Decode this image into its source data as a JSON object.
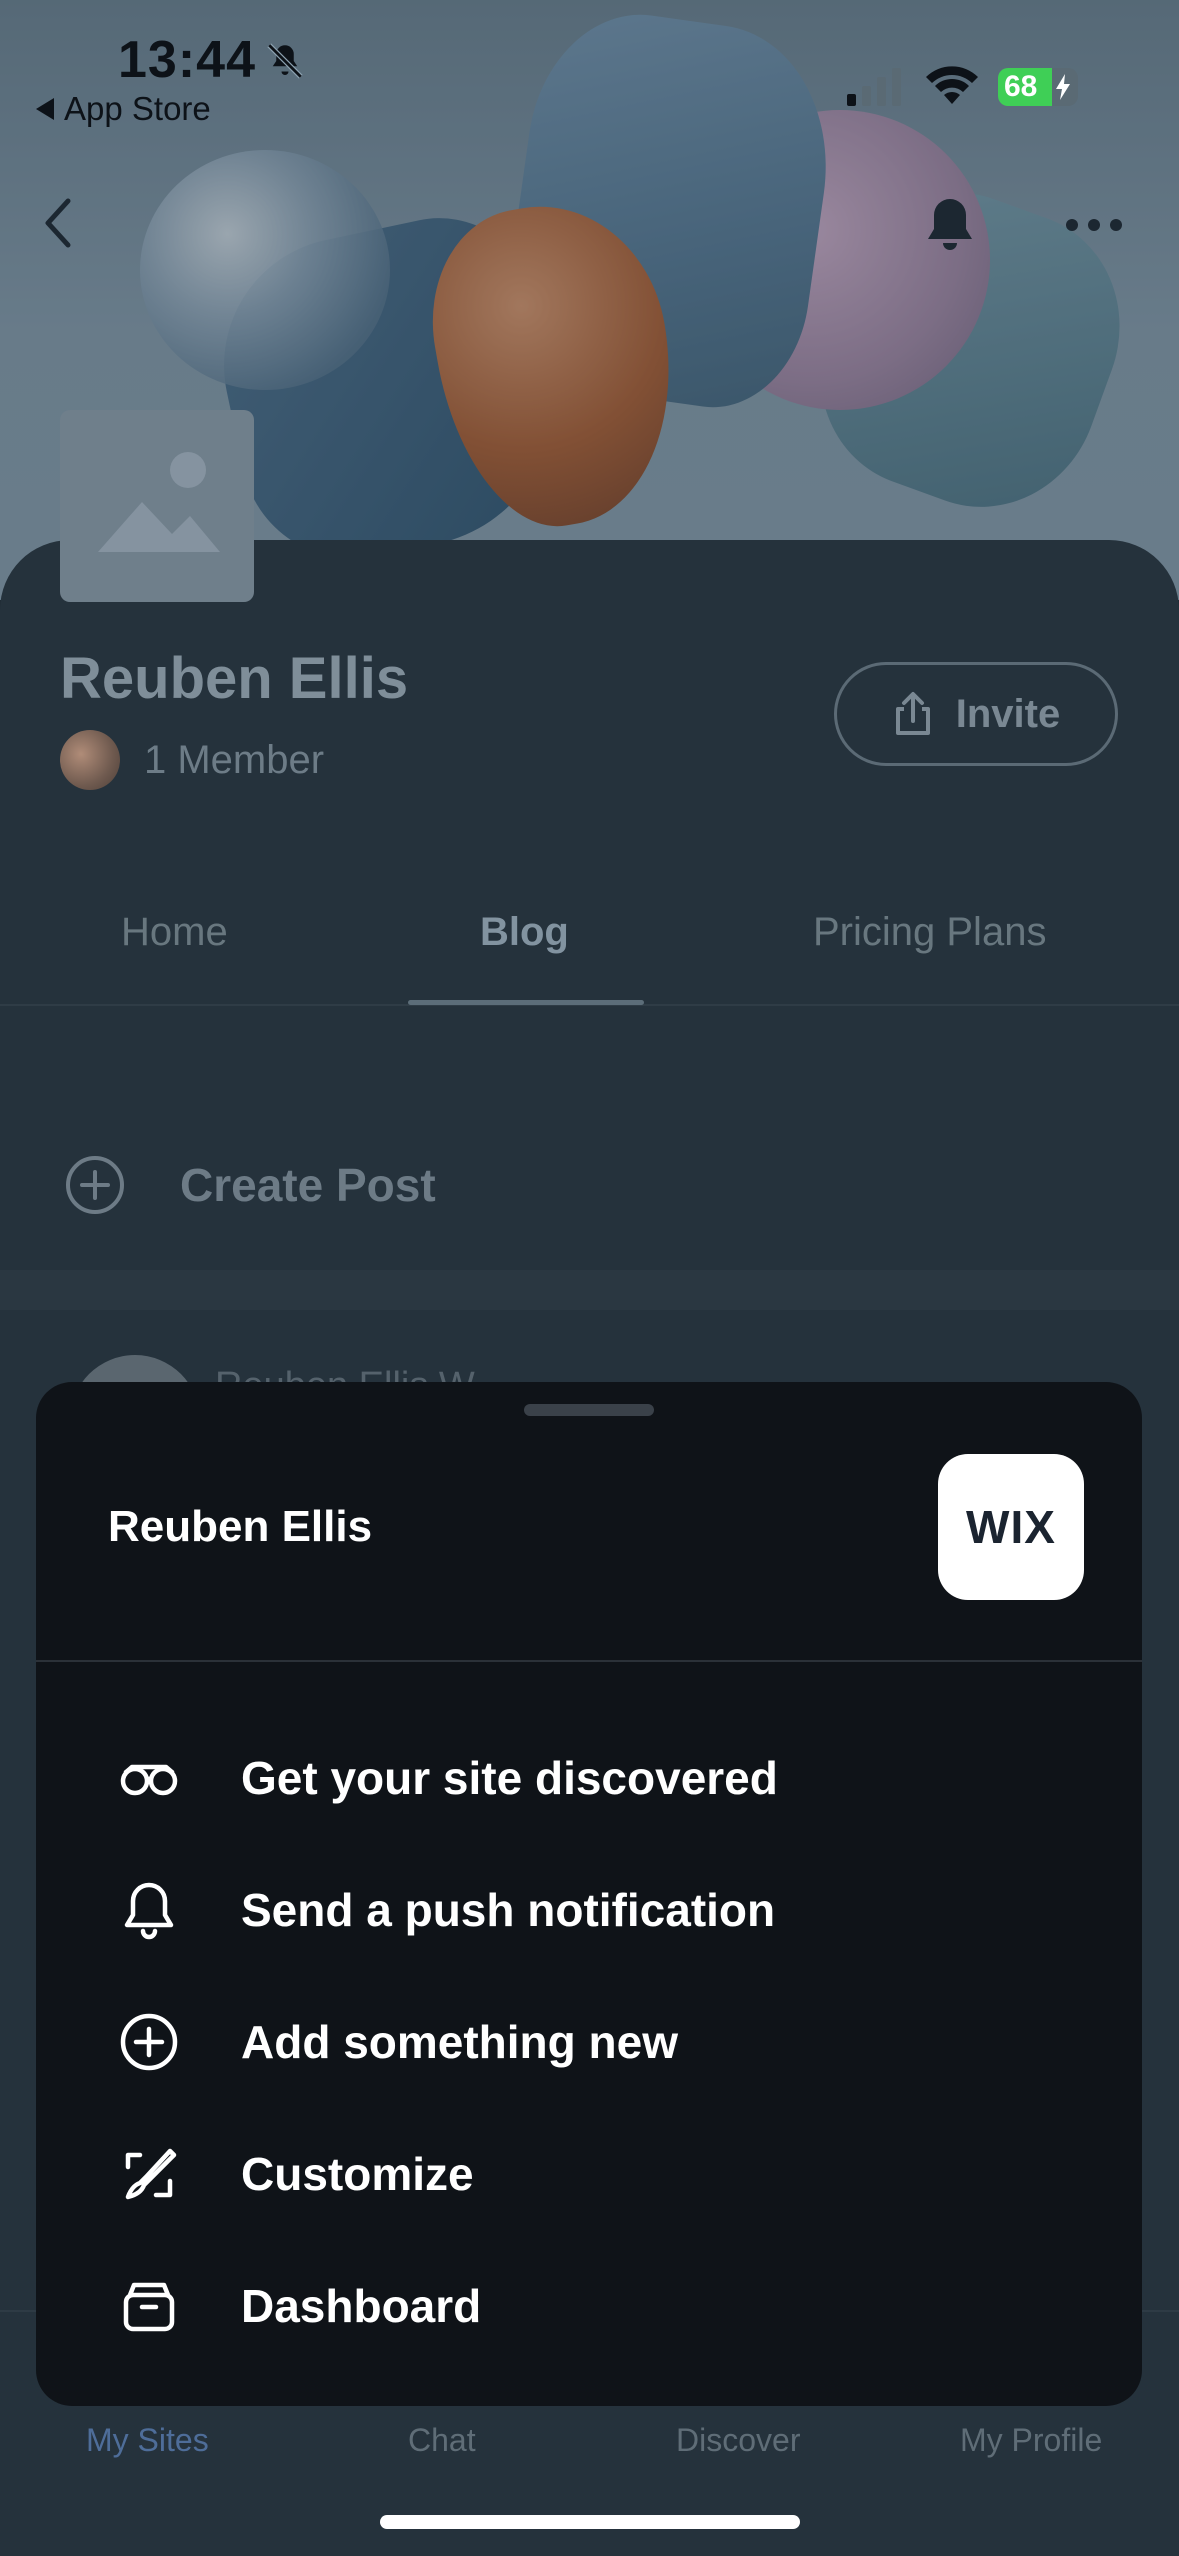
{
  "status_bar": {
    "time": "13:44",
    "back_label": "App Store",
    "battery": "68"
  },
  "site": {
    "name": "Reuben Ellis",
    "members": "1 Member",
    "invite_label": "Invite"
  },
  "tabs": [
    {
      "label": "Home"
    },
    {
      "label": "Blog",
      "active": true
    },
    {
      "label": "Pricing Plans"
    }
  ],
  "feed": {
    "create_post_label": "Create Post",
    "author_partial": "Reuben Ellis W..."
  },
  "bottom_nav": [
    {
      "label": "My Sites",
      "active": true
    },
    {
      "label": "Chat"
    },
    {
      "label": "Discover"
    },
    {
      "label": "My Profile"
    }
  ],
  "sheet": {
    "title": "Reuben Ellis",
    "logo_text": "WIX",
    "items": [
      {
        "label": "Get your site discovered",
        "icon": "binoculars-icon"
      },
      {
        "label": "Send a push notification",
        "icon": "bell-icon"
      },
      {
        "label": "Add something new",
        "icon": "plus-circle-icon"
      },
      {
        "label": "Customize",
        "icon": "brush-icon"
      },
      {
        "label": "Dashboard",
        "icon": "archive-box-icon"
      }
    ]
  },
  "colors": {
    "accent": "#4e6d99",
    "sheet_bg": "#0f1318",
    "battery_green": "#3fcf56"
  }
}
